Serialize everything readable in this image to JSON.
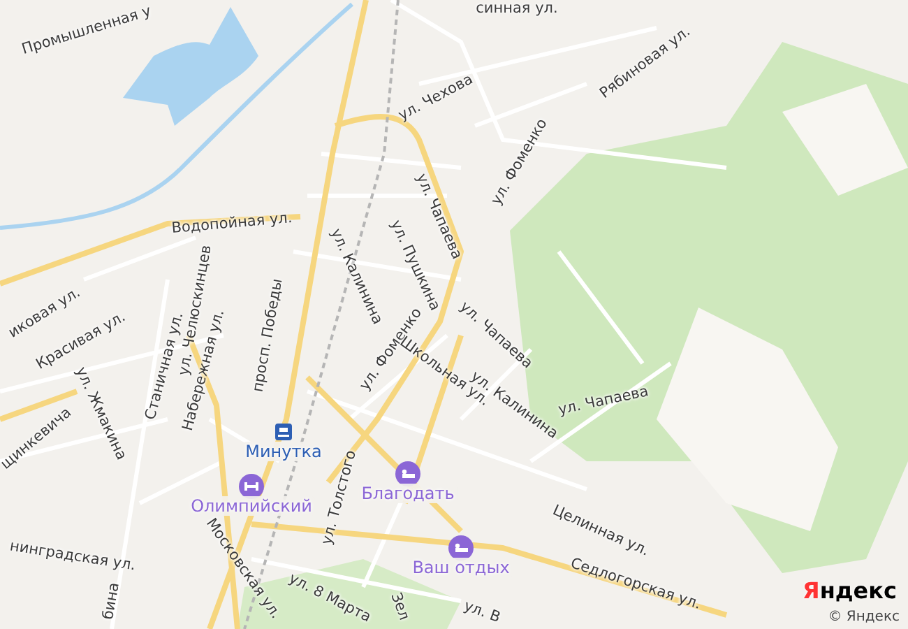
{
  "streets": [
    {
      "name": "Промышленная у"
    },
    {
      "name": "синная ул."
    },
    {
      "name": "ул. Чехова"
    },
    {
      "name": "Рябиновая ул."
    },
    {
      "name": "ул. Фоменко"
    },
    {
      "name": "ул. Чапаева"
    },
    {
      "name": "Водопойная ул."
    },
    {
      "name": "ул. Калинина"
    },
    {
      "name": "ул. Пушкина"
    },
    {
      "name": "иковая ул."
    },
    {
      "name": "Красивая ул."
    },
    {
      "name": "ул. Челюскинцев"
    },
    {
      "name": "ул. Чапаева"
    },
    {
      "name": "ул. Чапаева"
    },
    {
      "name": "ул. Фоменко"
    },
    {
      "name": "Школьная ул."
    },
    {
      "name": "ул. Калинина"
    },
    {
      "name": "Станичная ул."
    },
    {
      "name": "Набережная ул."
    },
    {
      "name": "просп. Победы"
    },
    {
      "name": "ул. Жмакина"
    },
    {
      "name": "щинкевича"
    },
    {
      "name": "ул. Толстого"
    },
    {
      "name": "Целинная ул."
    },
    {
      "name": "Седлогорская ул."
    },
    {
      "name": "нинградская ул."
    },
    {
      "name": "Московская ул."
    },
    {
      "name": "ул. 8 Марта"
    },
    {
      "name": "бина"
    },
    {
      "name": "Зел"
    },
    {
      "name": "ул. В"
    }
  ],
  "pois": [
    {
      "label": "Минутка",
      "kind": "station",
      "color": "#2d5fb4"
    },
    {
      "label": "Благодать",
      "kind": "hotel",
      "color": "#8b66d6"
    },
    {
      "label": "Олимпийский",
      "kind": "sport",
      "color": "#8b66d6"
    },
    {
      "label": "Ваш отдых",
      "kind": "hotel",
      "color": "#8b66d6"
    }
  ],
  "attribution": {
    "logo": "Яндекс",
    "copyright": "© Яндекс"
  }
}
